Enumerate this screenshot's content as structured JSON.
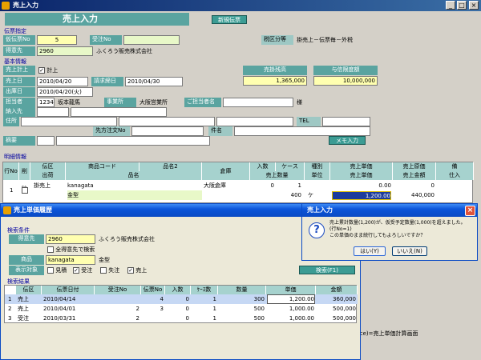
{
  "main": {
    "title": "売上入力",
    "header_title": "売上入力",
    "new_slip_button": "新規伝票",
    "slip_section": "伝票指定",
    "provisional_no_label": "仮伝票No",
    "provisional_no_value": "5",
    "order_no_label": "受注No",
    "tax_label": "税区分等",
    "tax_value": "掛売上－伝票毎－外税",
    "customer_label": "得意先",
    "customer_code": "2960",
    "customer_name": "ふくろう販売株式会社",
    "basic_section": "基本情報",
    "sales_calc_label": "売上計上",
    "sales_calc_check": "計上",
    "balance_label": "売掛残高",
    "balance_value": "1,365,000",
    "credit_label": "与信限度額",
    "credit_value": "10,000,000",
    "sales_date_label": "売上日",
    "sales_date_value": "2010/04/20",
    "billing_date_label": "請求締日",
    "billing_date_value": "2010/04/30",
    "ship_date_label": "出庫日",
    "ship_date_value": "2010/04/20(火)",
    "staff_label": "担当者",
    "staff_code": "1234",
    "staff_name": "坂本龍馬",
    "office_label": "事業所",
    "office_value": "大阪営業所",
    "contact_label": "ご担当者名",
    "contact_suffix": "様",
    "delivery_label": "納入先",
    "address_label": "住所",
    "tel_label": "TEL",
    "client_order_label": "先方注文No",
    "subject_label": "件名",
    "summary_label": "摘要",
    "memo_button": "メモ入力",
    "detail_section": "明細情報",
    "grid_headers_row1": [
      "行No",
      "削除",
      "伝区",
      "商品コード",
      "品名2",
      "倉庫",
      "入数",
      "ケース",
      "種別",
      "売上単価",
      "売上原価",
      "備"
    ],
    "grid_headers_row2": [
      "出荷",
      "品名",
      "売上数量",
      "単位",
      "売上単価",
      "売上金額",
      "仕入"
    ],
    "detail_row": {
      "no": "1",
      "type": "掛売上",
      "code": "kanagata",
      "name": "金型",
      "warehouse": "大阪倉庫",
      "qty_in": "0",
      "cases": "1",
      "qty": "400",
      "unit": "ケ",
      "unit_price": "1,200.00",
      "cost": "0.00",
      "cost_qty": "0",
      "amount": "440,000"
    },
    "status_text": "pace)=売上単価計算画面"
  },
  "history": {
    "title": "売上単価履歴",
    "cond_section": "検索条件",
    "customer_label": "得意先",
    "customer_code": "2960",
    "customer_name": "ふくろう販売株式会社",
    "all_customers": "全得意先で検索",
    "product_label": "商品",
    "product_code": "kanagata",
    "product_name": "金型",
    "display_label": "表示対象",
    "filters": [
      "見積",
      "受注",
      "失注",
      "売上"
    ],
    "search_button": "検索(F1)",
    "result_section": "検索結果",
    "headers": [
      "伝区",
      "伝票日付",
      "受注No",
      "伝票No",
      "入数",
      "ｹｰｽ数",
      "数量",
      "単価",
      "金額"
    ],
    "rows": [
      {
        "n": "1",
        "type": "売上",
        "date": "2010/04/14",
        "order": "",
        "slip": "4",
        "inq": "0",
        "cases": "1",
        "qty": "300",
        "price": "1,200.00",
        "amount": "360,000"
      },
      {
        "n": "2",
        "type": "売上",
        "date": "2010/04/01",
        "order": "2",
        "slip": "3",
        "inq": "0",
        "cases": "1",
        "qty": "500",
        "price": "1,000.00",
        "amount": "500,000"
      },
      {
        "n": "3",
        "type": "受注",
        "date": "2010/03/31",
        "order": "2",
        "slip": "",
        "inq": "0",
        "cases": "1",
        "qty": "500",
        "price": "1,000.00",
        "amount": "500,000"
      }
    ]
  },
  "dialog": {
    "title": "売上入力",
    "message_lines": [
      "売上累計数量(1,200)が、仮受予定数量(1,000)を超えました。",
      "(行No=1)",
      "この単価のまま続行してもよろしいですか？"
    ],
    "yes_button": "はい(Y)",
    "no_button": "いいえ(N)"
  }
}
